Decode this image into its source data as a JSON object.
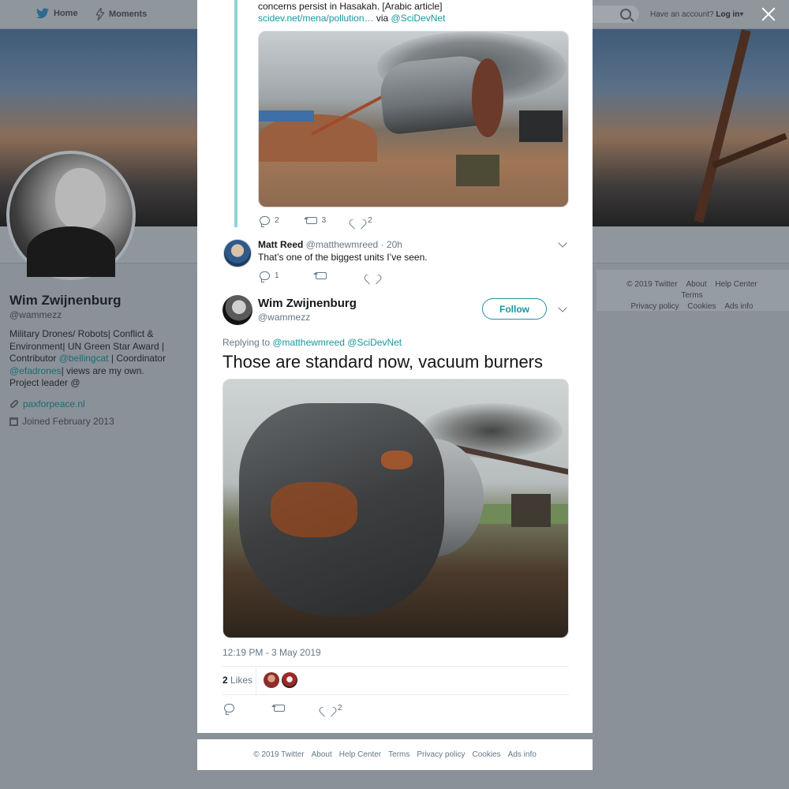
{
  "nav": {
    "home_label": "Home",
    "moments_label": "Moments",
    "account_prefix": "Have an account?",
    "login_label": "Log in"
  },
  "profile": {
    "name": "Wim Zwijnenburg",
    "handle": "@wammezz",
    "bio_parts": [
      "Military Drones/ Robots| Conflict & Environment| UN Green Star Award | Contributor ",
      "@bellingcat",
      " | Coordinator ",
      "@efadrones",
      "| views are my own. Project leader @"
    ],
    "website": "paxforpeace.nl",
    "joined": "Joined February 2013"
  },
  "side_footer": {
    "links": [
      "© 2019 Twitter",
      "About",
      "Help Center",
      "Terms",
      "Privacy policy",
      "Cookies",
      "Ads info"
    ]
  },
  "original_tweet": {
    "text_tail": "concerns persist in Hasakah. [Arabic article]",
    "link": "scidev.net/mena/pollution…",
    "via": " via ",
    "via_handle": "@SciDevNet",
    "reply_count": "2",
    "retweet_count": "3",
    "like_count": "2"
  },
  "reply_tweet": {
    "name": "Matt Reed",
    "handle": "@matthewmreed",
    "time": " · 20h",
    "text": "That’s one of the biggest units I’ve seen.",
    "reply_count": "1"
  },
  "main_tweet": {
    "name": "Wim Zwijnenburg",
    "handle": "@wammezz",
    "follow_label": "Follow",
    "replying_prefix": "Replying to ",
    "replying_handles": "@matthewmreed @SciDevNet",
    "text": "Those are standard now, vacuum burners",
    "timestamp": "12:19 PM - 3 May 2019",
    "likes_number": "2",
    "likes_label": " Likes",
    "like_count": "2"
  },
  "modal_footer": {
    "links": [
      "© 2019 Twitter",
      "About",
      "Help Center",
      "Terms",
      "Privacy policy",
      "Cookies",
      "Ads info"
    ]
  },
  "colors": {
    "accent": "#1b95a0",
    "thread_line": "#8fd3d6",
    "overlay_bg": "#8a9198"
  }
}
